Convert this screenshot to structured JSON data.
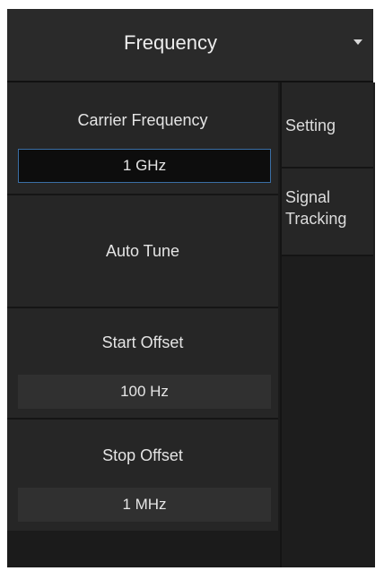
{
  "header": {
    "title": "Frequency",
    "dropdown_icon": "triangle-down-icon"
  },
  "sections": {
    "carrier_frequency": {
      "label": "Carrier Frequency",
      "value": "1 GHz"
    },
    "auto_tune": {
      "label": "Auto Tune"
    },
    "start_offset": {
      "label": "Start Offset",
      "value": "100 Hz"
    },
    "stop_offset": {
      "label": "Stop Offset",
      "value": "1 MHz"
    }
  },
  "tabs": [
    {
      "label": "Setting"
    },
    {
      "label": "Signal\nTracking"
    }
  ],
  "colors": {
    "panel_bg": "#1b1b1b",
    "section_bg": "#262626",
    "value_bg": "#303030",
    "active_border": "#3a6ea5",
    "text": "#e6e6e6"
  }
}
